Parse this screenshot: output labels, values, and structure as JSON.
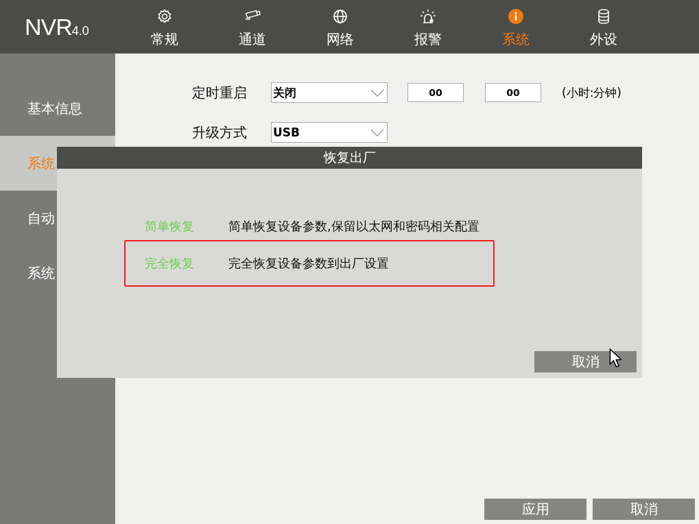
{
  "logo": {
    "name": "NVR",
    "version": "4.0"
  },
  "tabs": [
    {
      "label": "常规",
      "selected": false
    },
    {
      "label": "通道",
      "selected": false
    },
    {
      "label": "网络",
      "selected": false
    },
    {
      "label": "报警",
      "selected": false
    },
    {
      "label": "系统",
      "selected": true
    },
    {
      "label": "外设",
      "selected": false
    }
  ],
  "sidebar": {
    "items": [
      {
        "label": "基本信息",
        "selected": false
      },
      {
        "label": "系统",
        "selected": true
      },
      {
        "label": "自动",
        "selected": false
      },
      {
        "label": "系统",
        "selected": false
      }
    ]
  },
  "form": {
    "reboot": {
      "label": "定时重启",
      "value": "关闭",
      "hour": "00",
      "minute": "00",
      "unit": "(小时:分钟)"
    },
    "upgrade": {
      "label": "升级方式",
      "value": "USB"
    }
  },
  "dialog": {
    "title": "恢复出厂",
    "options": [
      {
        "name": "简单恢复",
        "description": "简单恢复设备参数,保留以太网和密码相关配置",
        "selected": false
      },
      {
        "name": "完全恢复",
        "description": "完全恢复设备参数到出厂设置",
        "selected": true
      }
    ],
    "cancel": "取消"
  },
  "buttons": [
    "应用",
    "取消"
  ]
}
